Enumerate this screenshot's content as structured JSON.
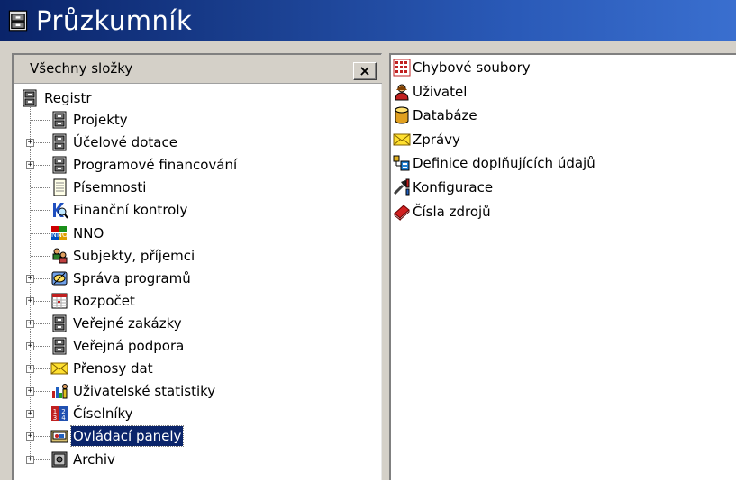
{
  "window": {
    "title": "Průzkumník",
    "icon": "cabinet-icon"
  },
  "left_pane": {
    "title": "Všechny složky",
    "close_label": "×",
    "root": {
      "label": "Registr",
      "icon": "cabinet-icon"
    },
    "items": [
      {
        "label": "Projekty",
        "icon": "cabinet-icon",
        "expandable": false,
        "selected": false
      },
      {
        "label": "Účelové dotace",
        "icon": "cabinet-icon",
        "expandable": true,
        "selected": false
      },
      {
        "label": "Programové financování",
        "icon": "cabinet-icon",
        "expandable": true,
        "selected": false
      },
      {
        "label": "Písemnosti",
        "icon": "document-icon",
        "expandable": false,
        "selected": false
      },
      {
        "label": "Finanční kontroly",
        "icon": "magnifier-check-icon",
        "expandable": false,
        "selected": false
      },
      {
        "label": "NNO",
        "icon": "ngo-icon",
        "expandable": false,
        "selected": false
      },
      {
        "label": "Subjekty, příjemci",
        "icon": "people-icon",
        "expandable": false,
        "selected": false
      },
      {
        "label": "Správa programů",
        "icon": "program-management-icon",
        "expandable": true,
        "selected": false
      },
      {
        "label": "Rozpočet",
        "icon": "budget-calendar-icon",
        "expandable": true,
        "selected": false
      },
      {
        "label": "Veřejné zakázky",
        "icon": "cabinet-icon",
        "expandable": true,
        "selected": false
      },
      {
        "label": "Veřejná podpora",
        "icon": "cabinet-icon",
        "expandable": true,
        "selected": false
      },
      {
        "label": "Přenosy dat",
        "icon": "envelope-icon",
        "expandable": true,
        "selected": false
      },
      {
        "label": "Uživatelské statistiky",
        "icon": "user-stats-icon",
        "expandable": true,
        "selected": false
      },
      {
        "label": "Číselníky",
        "icon": "codebook-icon",
        "expandable": true,
        "selected": false
      },
      {
        "label": "Ovládací panely",
        "icon": "control-panel-icon",
        "expandable": true,
        "selected": true
      },
      {
        "label": "Archiv",
        "icon": "archive-safe-icon",
        "expandable": true,
        "selected": false
      }
    ]
  },
  "right_pane": {
    "items": [
      {
        "label": "Chybové soubory",
        "icon": "error-files-icon"
      },
      {
        "label": "Uživatel",
        "icon": "user-icon"
      },
      {
        "label": "Databáze",
        "icon": "database-icon"
      },
      {
        "label": "Zprávy",
        "icon": "envelope-icon"
      },
      {
        "label": "Definice doplňujících údajů",
        "icon": "definitions-icon"
      },
      {
        "label": "Konfigurace",
        "icon": "tools-icon"
      },
      {
        "label": "Čísla zdrojů",
        "icon": "red-book-icon"
      }
    ]
  },
  "colors": {
    "titlebar_start": "#0a246a",
    "titlebar_end": "#3a6fcf",
    "selection": "#0a246a",
    "face": "#d4d0c8"
  }
}
